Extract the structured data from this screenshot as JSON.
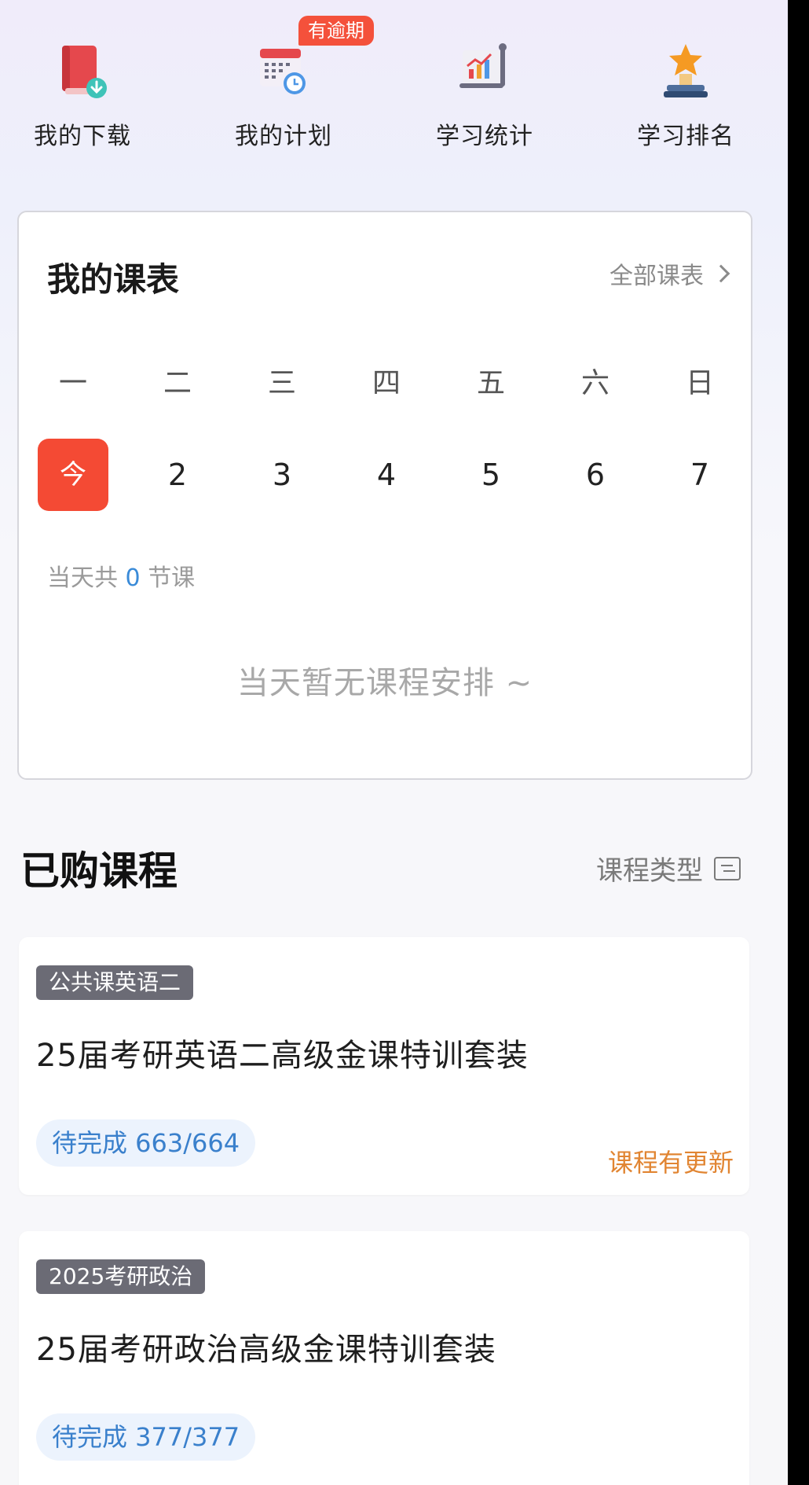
{
  "quick_actions": {
    "items": [
      {
        "label": "我的下载",
        "icon": "download-book-icon"
      },
      {
        "label": "我的计划",
        "icon": "calendar-clock-icon"
      },
      {
        "label": "学习统计",
        "icon": "statistics-chart-icon"
      },
      {
        "label": "学习排名",
        "icon": "trophy-ranking-icon"
      }
    ],
    "overdue_badge": "有逾期"
  },
  "schedule": {
    "title": "我的课表",
    "all_link": "全部课表",
    "weekdays": [
      "一",
      "二",
      "三",
      "四",
      "五",
      "六",
      "日"
    ],
    "dates": [
      "今",
      "2",
      "3",
      "4",
      "5",
      "6",
      "7"
    ],
    "count_prefix": "当天共",
    "count_value": "0",
    "count_suffix": "节课",
    "empty_message": "当天暂无课程安排 ~"
  },
  "purchased": {
    "title": "已购课程",
    "filter_label": "课程类型",
    "courses": [
      {
        "tag": "公共课英语二",
        "name": "25届考研英语二高级金课特训套装",
        "progress": "待完成 663/664",
        "update_note": "课程有更新"
      },
      {
        "tag": "2025考研政治",
        "name": "25届考研政治高级金课特训套装",
        "progress": "待完成 377/377"
      }
    ]
  },
  "colors": {
    "accent_red": "#f44a34",
    "progress_blue": "#3a80cc",
    "update_orange": "#e18532"
  }
}
